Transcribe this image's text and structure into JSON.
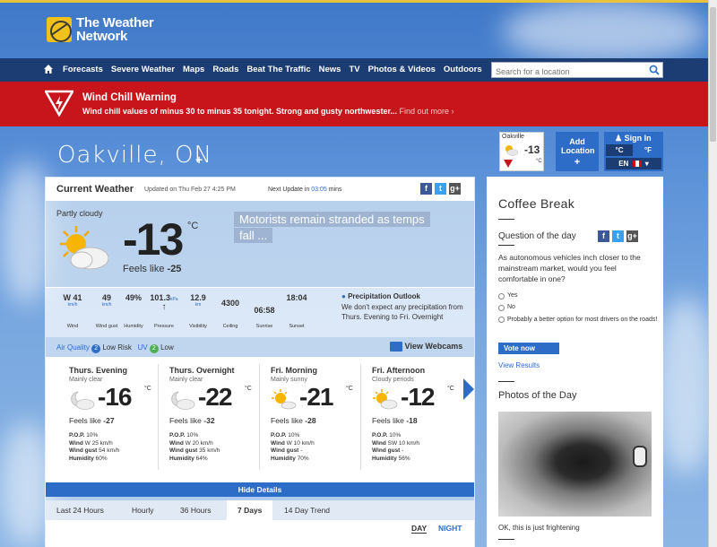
{
  "header": {
    "logo_line1": "The Weather",
    "logo_line2": "Network"
  },
  "nav": {
    "items": [
      "Forecasts",
      "Severe Weather",
      "Maps",
      "Roads",
      "Beat The Traffic",
      "News",
      "TV",
      "Photos & Videos",
      "Outdoors"
    ],
    "search_placeholder": "Search for a location"
  },
  "warning": {
    "title": "Wind Chill Warning",
    "text": "Wind chill values of minus 30 to minus 35 tonight. Strong and gusty northwester...",
    "link": "Find out more ›"
  },
  "location": {
    "city": "Oakville, ON",
    "add": "+"
  },
  "mini_widget": {
    "city": "Oakville",
    "temp": "-13",
    "unit": "°C"
  },
  "account": {
    "add_location": "Add Location",
    "add_plus": "+",
    "sign_in": "Sign In",
    "unit_c": "°C",
    "unit_f": "°F",
    "lang": "EN"
  },
  "current": {
    "title": "Current Weather",
    "updated": "Updated on Thu Feb 27 4:25 PM",
    "next_update_label": "Next Update in",
    "next_update_time": "03:05",
    "next_update_unit": "mins",
    "condition": "Partly cloudy",
    "temp": "-13",
    "unit": "°C",
    "feels_label": "Feels like",
    "feels_value": "-25",
    "news": "Motorists remain stranded as temps fall ...",
    "details": [
      {
        "value": "W 41",
        "unit": "km/h",
        "label": "Wind"
      },
      {
        "value": "49",
        "unit": "km/h",
        "label": "Wind gust"
      },
      {
        "value": "49%",
        "unit": "",
        "label": "Humidity"
      },
      {
        "value": "101.3",
        "unit": "kPa",
        "label": "Pressure"
      },
      {
        "value": "12.9",
        "unit": "km",
        "label": "Visibility"
      },
      {
        "value": "4300",
        "unit": "ft",
        "label": "Ceiling"
      },
      {
        "value": "06:58",
        "unit": "",
        "label": "Sunrise"
      },
      {
        "value": "18:04",
        "unit": "",
        "label": "Sunset"
      }
    ],
    "precip_title": "Precipitation Outlook",
    "precip_text": "We don't expect any precipitation from Thurs. Evening to Fri. Overnight",
    "air_quality_label": "Air Quality",
    "air_quality_value": "2",
    "air_quality_text": "Low Risk",
    "uv_label": "UV",
    "uv_value": "2",
    "uv_text": "Low",
    "webcams": "View Webcams"
  },
  "forecast": [
    {
      "period": "Thurs. Evening",
      "condition": "Mainly clear",
      "temp": "-16",
      "unit": "°C",
      "feels": "-27",
      "pop": "10%",
      "wind": "W 25 km/h",
      "gust": "54 km/h",
      "humidity": "60%"
    },
    {
      "period": "Thurs. Overnight",
      "condition": "Mainly clear",
      "temp": "-22",
      "unit": "°C",
      "feels": "-32",
      "pop": "10%",
      "wind": "W 20 km/h",
      "gust": "35 km/h",
      "humidity": "64%"
    },
    {
      "period": "Fri. Morning",
      "condition": "Mainly sunny",
      "temp": "-21",
      "unit": "°C",
      "feels": "-28",
      "pop": "10%",
      "wind": "W 10 km/h",
      "gust": "-",
      "humidity": "70%"
    },
    {
      "period": "Fri. Afternoon",
      "condition": "Cloudy periods",
      "temp": "-12",
      "unit": "°C",
      "feels": "-18",
      "pop": "10%",
      "wind": "SW 10 km/h",
      "gust": "-",
      "humidity": "56%"
    }
  ],
  "forecast_labels": {
    "feels": "Feels like",
    "pop": "P.O.P.",
    "wind": "Wind",
    "gust": "Wind gust",
    "humidity": "Humidity"
  },
  "hide_details": "Hide Details",
  "tabs": [
    "Last 24 Hours",
    "Hourly",
    "36 Hours",
    "7 Days",
    "14 Day Trend"
  ],
  "day_night": {
    "day": "DAY",
    "night": "NIGHT"
  },
  "sidebar": {
    "title": "Coffee Break",
    "question_title": "Question of the day",
    "question": "As autonomous vehicles inch closer to the mainstream market, would you feel comfortable in one?",
    "options": [
      "Yes",
      "No",
      "Probably a better option for most drivers on the roads!"
    ],
    "vote": "Vote now",
    "view_results": "View Results",
    "photos_title": "Photos of the Day",
    "photo_caption": "OK, this is just frightening"
  },
  "colors": {
    "nav": "#1c3d74",
    "warning": "#c8151b",
    "accent": "#2d6cc7",
    "logo": "#f1c21b"
  }
}
